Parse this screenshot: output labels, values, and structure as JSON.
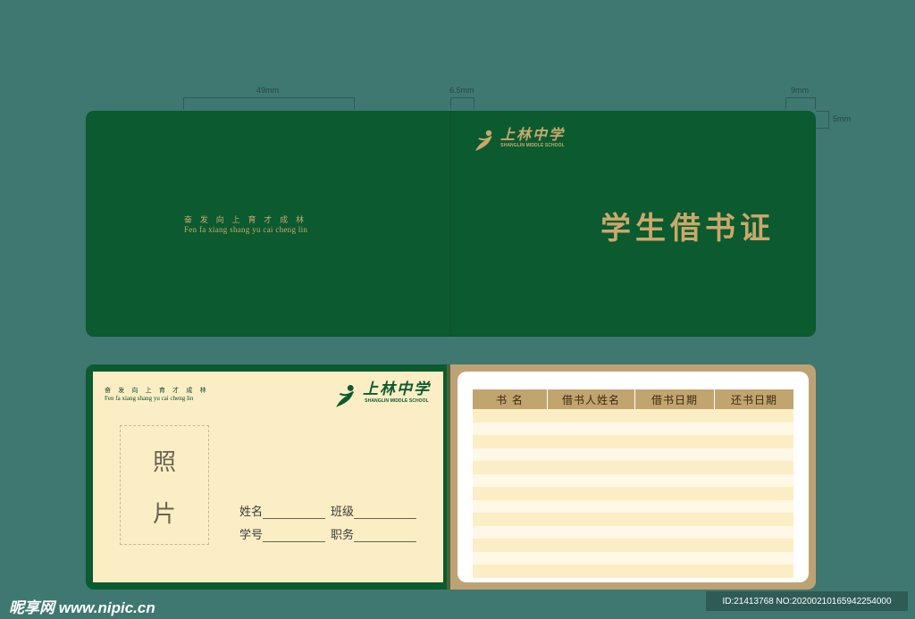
{
  "dimensions": {
    "spine_width_label": "49mm",
    "fold_label": "6.5mm",
    "corner_w_label": "9mm",
    "corner_h_label": "5mm"
  },
  "cover": {
    "motto_cn": "奋 发 向 上   育 才 成 林",
    "motto_pinyin": "Fen fa xiang shang yu cai cheng lin",
    "logo_cn": "上林中学",
    "logo_en": "SHANGLIN MIDDLE SCHOOL",
    "title": "学生借书证"
  },
  "inner": {
    "motto_cn": "奋 发 向 上   育 才 成 林",
    "motto_pinyin": "Fen fa xiang shang yu cai cheng lin",
    "logo_cn": "上林中学",
    "logo_en": "SHANGLIN MIDDLE SCHOOL",
    "photo_char1": "照",
    "photo_char2": "片",
    "fields": {
      "name": "姓名",
      "class": "班级",
      "student_id": "学号",
      "position": "职务"
    },
    "table": {
      "headers": [
        "书   名",
        "借书人姓名",
        "借书日期",
        "还书日期"
      ]
    }
  },
  "watermark": {
    "site": "昵享网 www.nipic.cn",
    "id": "ID:21413768 NO:20200210165942254000"
  },
  "colors": {
    "background": "#3f7870",
    "cover_green": "#0c5a30",
    "gold": "#c9a96b",
    "cream": "#fbeec5"
  }
}
